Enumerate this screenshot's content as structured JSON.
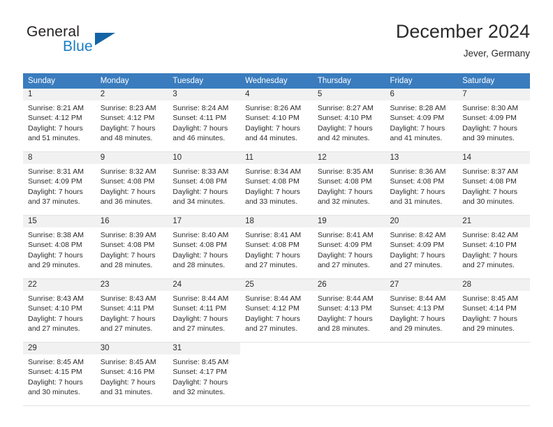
{
  "brand": {
    "word_top": "General",
    "word_bottom": "Blue",
    "icon": "triangle-logo-icon",
    "color_top": "#231f20",
    "color_bottom": "#1a7dc4",
    "triangle_color": "#1464a5"
  },
  "header": {
    "title": "December 2024",
    "location": "Jever, Germany"
  },
  "colors": {
    "header_row_bg": "#3a7cbe",
    "header_row_text": "#ffffff",
    "daynum_bg": "#f1f1f1",
    "cell_text": "#2b2b2b",
    "row_divider": "#e3e3e3"
  },
  "weekday_headers": [
    "Sunday",
    "Monday",
    "Tuesday",
    "Wednesday",
    "Thursday",
    "Friday",
    "Saturday"
  ],
  "weeks": [
    [
      {
        "day": "1",
        "sunrise": "Sunrise: 8:21 AM",
        "sunset": "Sunset: 4:12 PM",
        "daylight1": "Daylight: 7 hours",
        "daylight2": "and 51 minutes."
      },
      {
        "day": "2",
        "sunrise": "Sunrise: 8:23 AM",
        "sunset": "Sunset: 4:12 PM",
        "daylight1": "Daylight: 7 hours",
        "daylight2": "and 48 minutes."
      },
      {
        "day": "3",
        "sunrise": "Sunrise: 8:24 AM",
        "sunset": "Sunset: 4:11 PM",
        "daylight1": "Daylight: 7 hours",
        "daylight2": "and 46 minutes."
      },
      {
        "day": "4",
        "sunrise": "Sunrise: 8:26 AM",
        "sunset": "Sunset: 4:10 PM",
        "daylight1": "Daylight: 7 hours",
        "daylight2": "and 44 minutes."
      },
      {
        "day": "5",
        "sunrise": "Sunrise: 8:27 AM",
        "sunset": "Sunset: 4:10 PM",
        "daylight1": "Daylight: 7 hours",
        "daylight2": "and 42 minutes."
      },
      {
        "day": "6",
        "sunrise": "Sunrise: 8:28 AM",
        "sunset": "Sunset: 4:09 PM",
        "daylight1": "Daylight: 7 hours",
        "daylight2": "and 41 minutes."
      },
      {
        "day": "7",
        "sunrise": "Sunrise: 8:30 AM",
        "sunset": "Sunset: 4:09 PM",
        "daylight1": "Daylight: 7 hours",
        "daylight2": "and 39 minutes."
      }
    ],
    [
      {
        "day": "8",
        "sunrise": "Sunrise: 8:31 AM",
        "sunset": "Sunset: 4:09 PM",
        "daylight1": "Daylight: 7 hours",
        "daylight2": "and 37 minutes."
      },
      {
        "day": "9",
        "sunrise": "Sunrise: 8:32 AM",
        "sunset": "Sunset: 4:08 PM",
        "daylight1": "Daylight: 7 hours",
        "daylight2": "and 36 minutes."
      },
      {
        "day": "10",
        "sunrise": "Sunrise: 8:33 AM",
        "sunset": "Sunset: 4:08 PM",
        "daylight1": "Daylight: 7 hours",
        "daylight2": "and 34 minutes."
      },
      {
        "day": "11",
        "sunrise": "Sunrise: 8:34 AM",
        "sunset": "Sunset: 4:08 PM",
        "daylight1": "Daylight: 7 hours",
        "daylight2": "and 33 minutes."
      },
      {
        "day": "12",
        "sunrise": "Sunrise: 8:35 AM",
        "sunset": "Sunset: 4:08 PM",
        "daylight1": "Daylight: 7 hours",
        "daylight2": "and 32 minutes."
      },
      {
        "day": "13",
        "sunrise": "Sunrise: 8:36 AM",
        "sunset": "Sunset: 4:08 PM",
        "daylight1": "Daylight: 7 hours",
        "daylight2": "and 31 minutes."
      },
      {
        "day": "14",
        "sunrise": "Sunrise: 8:37 AM",
        "sunset": "Sunset: 4:08 PM",
        "daylight1": "Daylight: 7 hours",
        "daylight2": "and 30 minutes."
      }
    ],
    [
      {
        "day": "15",
        "sunrise": "Sunrise: 8:38 AM",
        "sunset": "Sunset: 4:08 PM",
        "daylight1": "Daylight: 7 hours",
        "daylight2": "and 29 minutes."
      },
      {
        "day": "16",
        "sunrise": "Sunrise: 8:39 AM",
        "sunset": "Sunset: 4:08 PM",
        "daylight1": "Daylight: 7 hours",
        "daylight2": "and 28 minutes."
      },
      {
        "day": "17",
        "sunrise": "Sunrise: 8:40 AM",
        "sunset": "Sunset: 4:08 PM",
        "daylight1": "Daylight: 7 hours",
        "daylight2": "and 28 minutes."
      },
      {
        "day": "18",
        "sunrise": "Sunrise: 8:41 AM",
        "sunset": "Sunset: 4:08 PM",
        "daylight1": "Daylight: 7 hours",
        "daylight2": "and 27 minutes."
      },
      {
        "day": "19",
        "sunrise": "Sunrise: 8:41 AM",
        "sunset": "Sunset: 4:09 PM",
        "daylight1": "Daylight: 7 hours",
        "daylight2": "and 27 minutes."
      },
      {
        "day": "20",
        "sunrise": "Sunrise: 8:42 AM",
        "sunset": "Sunset: 4:09 PM",
        "daylight1": "Daylight: 7 hours",
        "daylight2": "and 27 minutes."
      },
      {
        "day": "21",
        "sunrise": "Sunrise: 8:42 AM",
        "sunset": "Sunset: 4:10 PM",
        "daylight1": "Daylight: 7 hours",
        "daylight2": "and 27 minutes."
      }
    ],
    [
      {
        "day": "22",
        "sunrise": "Sunrise: 8:43 AM",
        "sunset": "Sunset: 4:10 PM",
        "daylight1": "Daylight: 7 hours",
        "daylight2": "and 27 minutes."
      },
      {
        "day": "23",
        "sunrise": "Sunrise: 8:43 AM",
        "sunset": "Sunset: 4:11 PM",
        "daylight1": "Daylight: 7 hours",
        "daylight2": "and 27 minutes."
      },
      {
        "day": "24",
        "sunrise": "Sunrise: 8:44 AM",
        "sunset": "Sunset: 4:11 PM",
        "daylight1": "Daylight: 7 hours",
        "daylight2": "and 27 minutes."
      },
      {
        "day": "25",
        "sunrise": "Sunrise: 8:44 AM",
        "sunset": "Sunset: 4:12 PM",
        "daylight1": "Daylight: 7 hours",
        "daylight2": "and 27 minutes."
      },
      {
        "day": "26",
        "sunrise": "Sunrise: 8:44 AM",
        "sunset": "Sunset: 4:13 PM",
        "daylight1": "Daylight: 7 hours",
        "daylight2": "and 28 minutes."
      },
      {
        "day": "27",
        "sunrise": "Sunrise: 8:44 AM",
        "sunset": "Sunset: 4:13 PM",
        "daylight1": "Daylight: 7 hours",
        "daylight2": "and 29 minutes."
      },
      {
        "day": "28",
        "sunrise": "Sunrise: 8:45 AM",
        "sunset": "Sunset: 4:14 PM",
        "daylight1": "Daylight: 7 hours",
        "daylight2": "and 29 minutes."
      }
    ],
    [
      {
        "day": "29",
        "sunrise": "Sunrise: 8:45 AM",
        "sunset": "Sunset: 4:15 PM",
        "daylight1": "Daylight: 7 hours",
        "daylight2": "and 30 minutes."
      },
      {
        "day": "30",
        "sunrise": "Sunrise: 8:45 AM",
        "sunset": "Sunset: 4:16 PM",
        "daylight1": "Daylight: 7 hours",
        "daylight2": "and 31 minutes."
      },
      {
        "day": "31",
        "sunrise": "Sunrise: 8:45 AM",
        "sunset": "Sunset: 4:17 PM",
        "daylight1": "Daylight: 7 hours",
        "daylight2": "and 32 minutes."
      },
      {
        "day": "",
        "sunrise": "",
        "sunset": "",
        "daylight1": "",
        "daylight2": ""
      },
      {
        "day": "",
        "sunrise": "",
        "sunset": "",
        "daylight1": "",
        "daylight2": ""
      },
      {
        "day": "",
        "sunrise": "",
        "sunset": "",
        "daylight1": "",
        "daylight2": ""
      },
      {
        "day": "",
        "sunrise": "",
        "sunset": "",
        "daylight1": "",
        "daylight2": ""
      }
    ]
  ]
}
